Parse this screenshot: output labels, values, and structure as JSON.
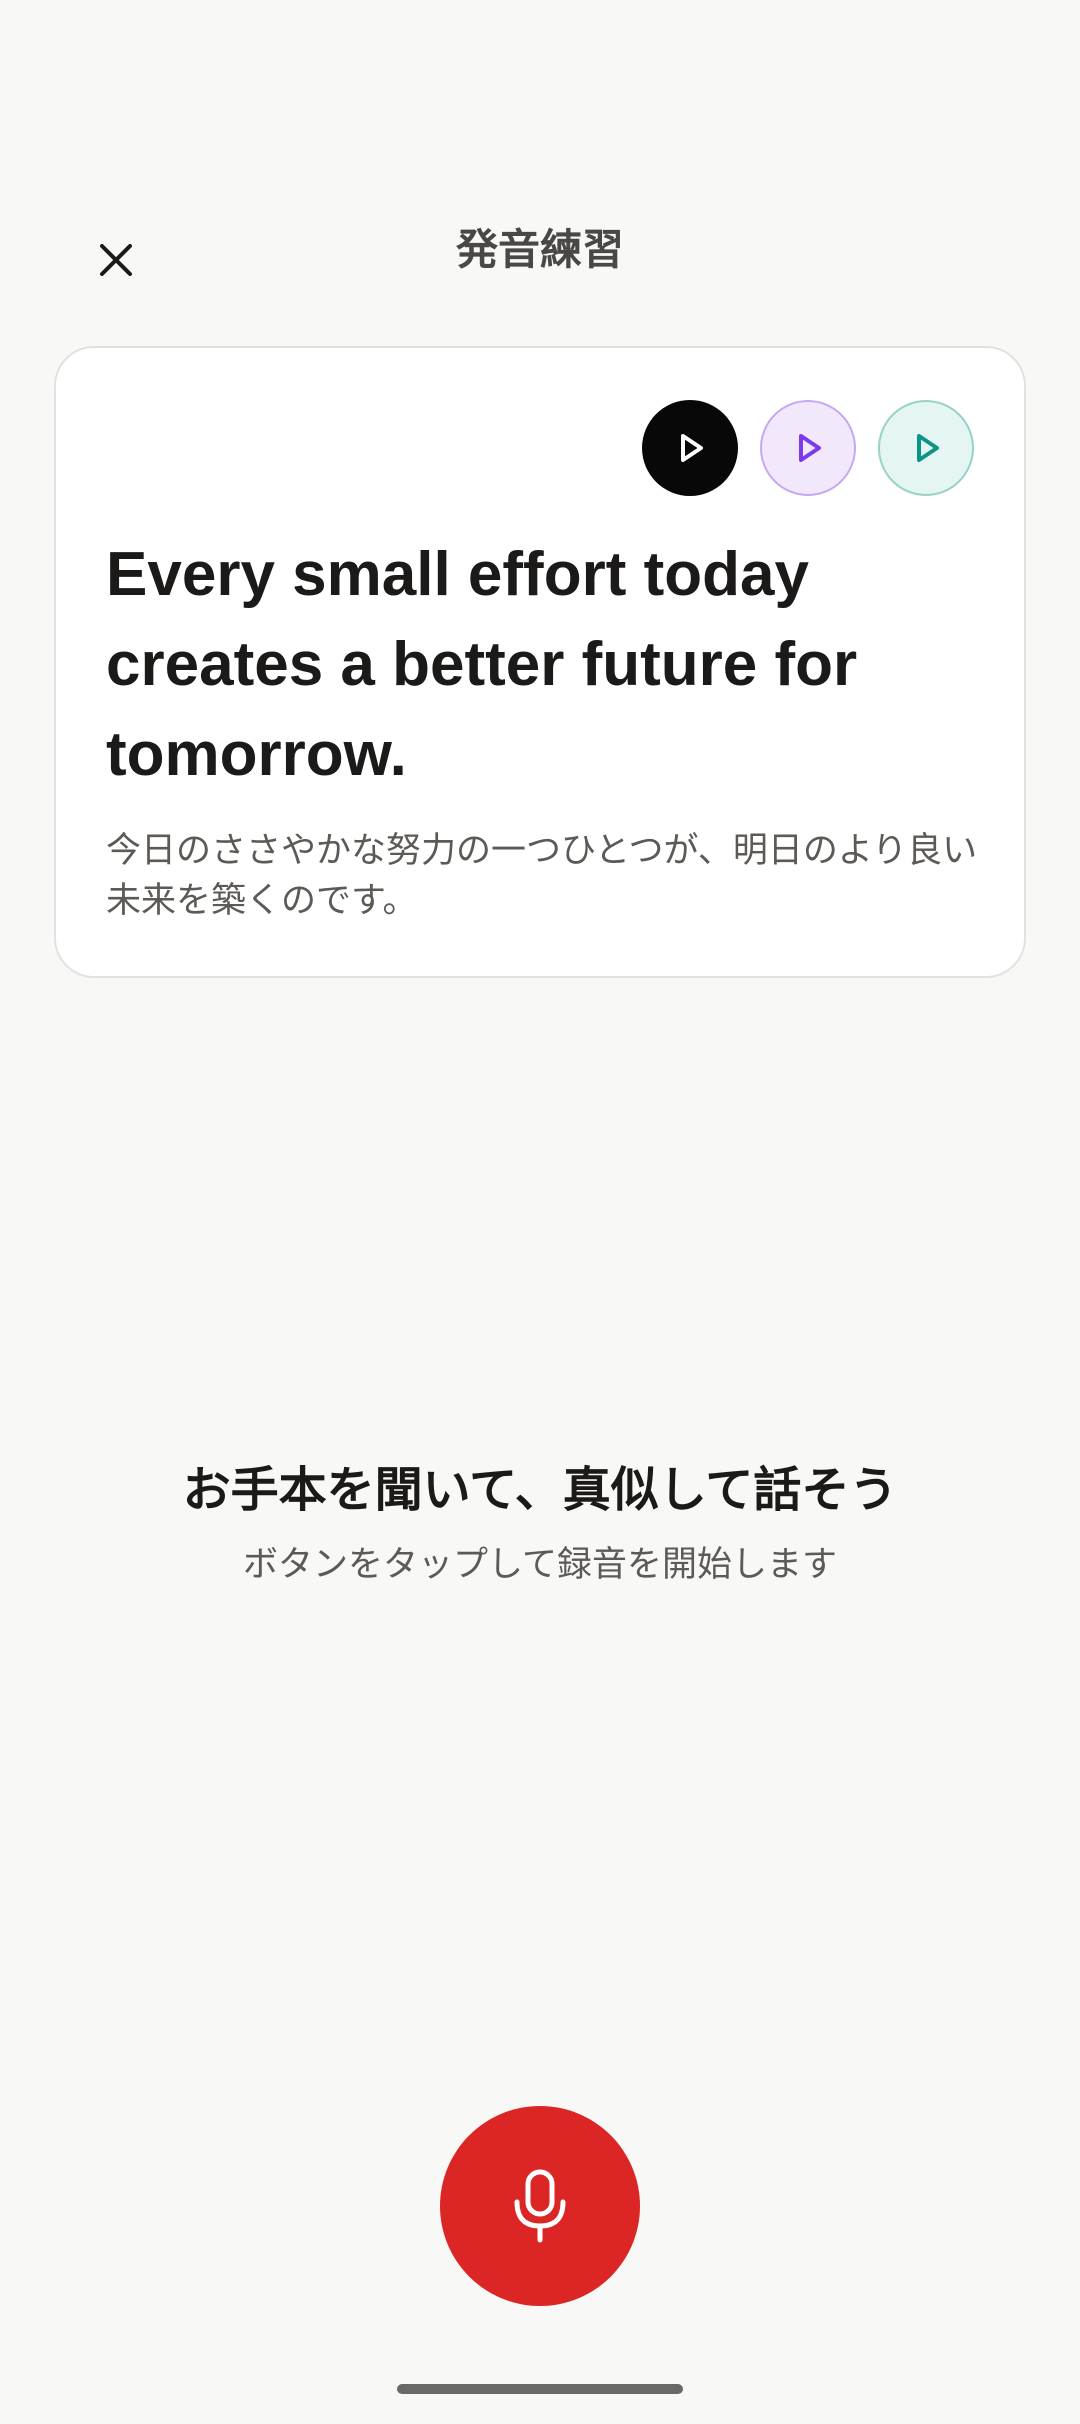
{
  "header": {
    "title": "発音練習",
    "close_icon": "close-icon"
  },
  "card": {
    "play_buttons": [
      {
        "icon": "play-icon",
        "color": "#080808"
      },
      {
        "icon": "play-icon",
        "color": "#7c3aed"
      },
      {
        "icon": "play-icon",
        "color": "#0d9488"
      }
    ],
    "sentence": "Every small effort today creates a better future for tomorrow.",
    "translation": "今日のささやかな努力の一つひとつが、明日のより良い未来を築くのです。"
  },
  "prompt": {
    "title": "お手本を聞いて、真似して話そう",
    "subtitle": "ボタンをタップして録音を開始します"
  },
  "record": {
    "icon": "microphone-icon",
    "color": "#dc2626"
  }
}
